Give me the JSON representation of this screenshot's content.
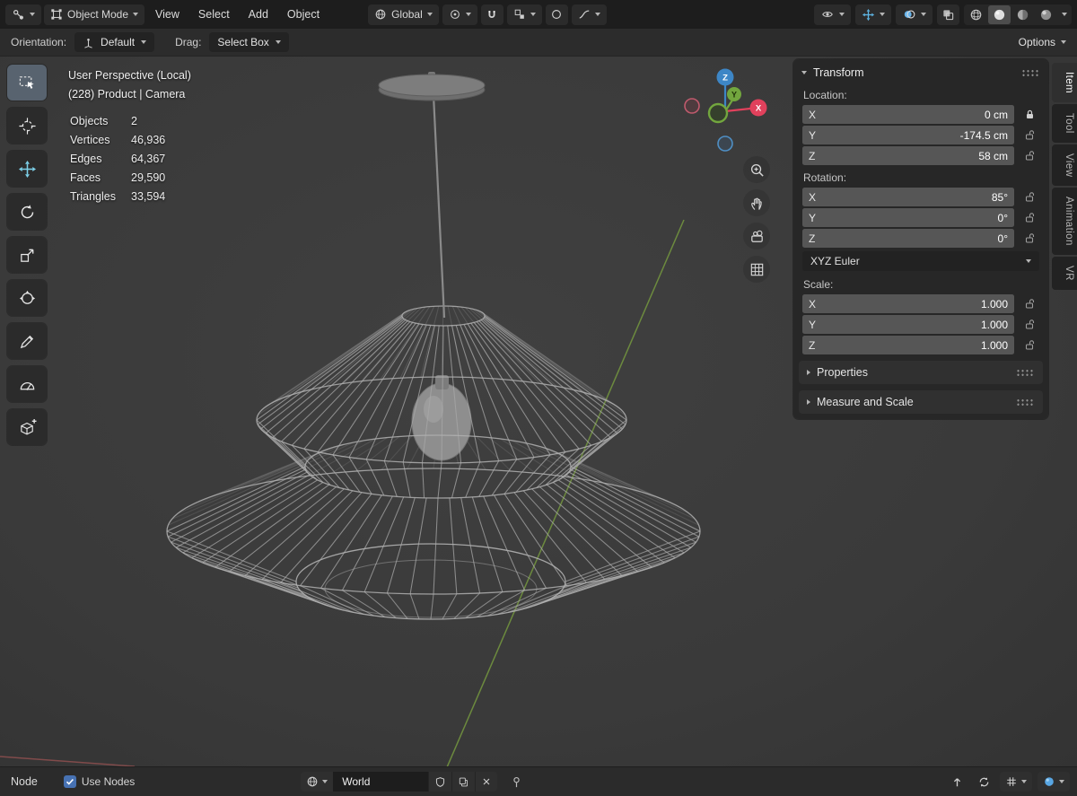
{
  "colors": {
    "accent_blue": "#4772b3",
    "axis_x": "#e1415c",
    "axis_y": "#72a63e",
    "axis_z": "#3d86c6",
    "header_bg": "#1d1d1d",
    "viewport_bg": "#3a3a3a"
  },
  "topbar": {
    "mode": "Object Mode",
    "menus": [
      "View",
      "Select",
      "Add",
      "Object"
    ],
    "orientation": "Global"
  },
  "toolrow": {
    "orientation_label": "Orientation:",
    "orientation_value": "Default",
    "drag_label": "Drag:",
    "drag_value": "Select Box",
    "options": "Options"
  },
  "viewport": {
    "title": "User Perspective (Local)",
    "subtitle": "(228) Product | Camera",
    "stats": [
      {
        "label": "Objects",
        "value": "2"
      },
      {
        "label": "Vertices",
        "value": "46,936"
      },
      {
        "label": "Edges",
        "value": "64,367"
      },
      {
        "label": "Faces",
        "value": "29,590"
      },
      {
        "label": "Triangles",
        "value": "33,594"
      }
    ],
    "axis": {
      "x": "X",
      "y": "Y",
      "z": "Z"
    }
  },
  "npanel": {
    "tabs": [
      "Item",
      "Tool",
      "View",
      "Animation",
      "VR"
    ],
    "transform_title": "Transform",
    "location_label": "Location:",
    "location": [
      {
        "axis": "X",
        "value": "0 cm"
      },
      {
        "axis": "Y",
        "value": "-174.5 cm"
      },
      {
        "axis": "Z",
        "value": "58 cm"
      }
    ],
    "rotation_label": "Rotation:",
    "rotation": [
      {
        "axis": "X",
        "value": "85°"
      },
      {
        "axis": "Y",
        "value": "0°"
      },
      {
        "axis": "Z",
        "value": "0°"
      }
    ],
    "rotation_mode": "XYZ Euler",
    "scale_label": "Scale:",
    "scale": [
      {
        "axis": "X",
        "value": "1.000"
      },
      {
        "axis": "Y",
        "value": "1.000"
      },
      {
        "axis": "Z",
        "value": "1.000"
      }
    ],
    "panels": [
      "Properties",
      "Measure and Scale"
    ]
  },
  "bottombar": {
    "menu": "Node",
    "use_nodes": "Use Nodes",
    "world": "World"
  }
}
